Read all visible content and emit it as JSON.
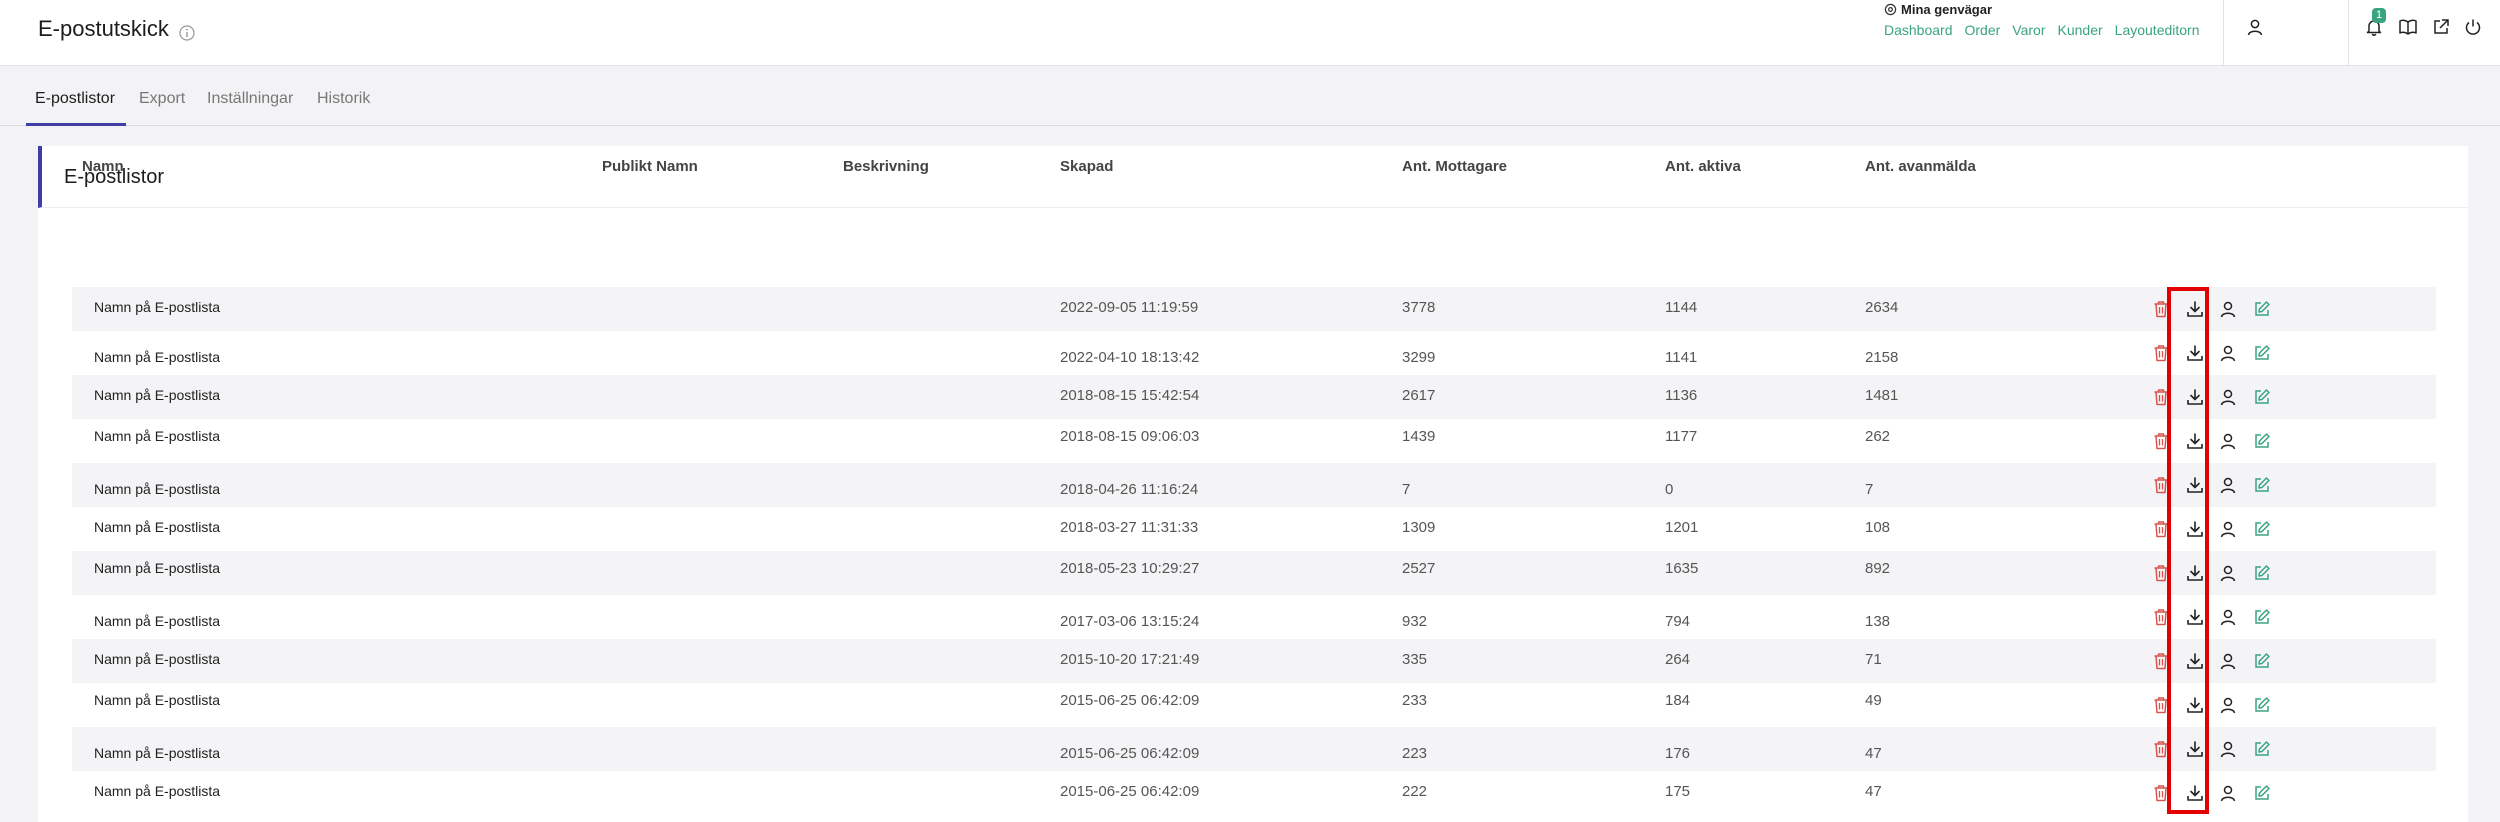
{
  "header": {
    "title": "E-postutskick",
    "shortcuts_title": "Mina genvägar",
    "shortcuts": [
      "Dashboard",
      "Order",
      "Varor",
      "Kunder",
      "Layouteditorn"
    ],
    "notification_count": "1"
  },
  "tabs": [
    "E-postlistor",
    "Export",
    "Inställningar",
    "Historik"
  ],
  "card": {
    "title": "E-postlistor"
  },
  "table": {
    "columns": [
      "Namn",
      "Publikt Namn",
      "Beskrivning",
      "Skapad",
      "Ant. Mottagare",
      "Ant. aktiva",
      "Ant. avanmälda"
    ],
    "rows": [
      {
        "name": "Namn på E-postlista",
        "public": "",
        "desc": "",
        "created": "2022-09-05 11:19:59",
        "recipients": "3778",
        "active": "1144",
        "unsub": "2634"
      },
      {
        "name": "Namn på E-postlista",
        "public": "",
        "desc": "",
        "created": "2022-04-10 18:13:42",
        "recipients": "3299",
        "active": "1141",
        "unsub": "2158"
      },
      {
        "name": "Namn på E-postlista",
        "public": "",
        "desc": "",
        "created": "2018-08-15 15:42:54",
        "recipients": "2617",
        "active": "1136",
        "unsub": "1481"
      },
      {
        "name": "Namn på E-postlista",
        "public": "",
        "desc": "",
        "created": "2018-08-15 09:06:03",
        "recipients": "1439",
        "active": "1177",
        "unsub": "262"
      },
      {
        "name": "Namn på E-postlista",
        "public": "",
        "desc": "",
        "created": "2018-04-26 11:16:24",
        "recipients": "7",
        "active": "0",
        "unsub": "7"
      },
      {
        "name": "Namn på E-postlista",
        "public": "",
        "desc": "",
        "created": "2018-03-27 11:31:33",
        "recipients": "1309",
        "active": "1201",
        "unsub": "108"
      },
      {
        "name": "Namn på E-postlista",
        "public": "",
        "desc": "",
        "created": "2018-05-23 10:29:27",
        "recipients": "2527",
        "active": "1635",
        "unsub": "892"
      },
      {
        "name": "Namn på E-postlista",
        "public": "",
        "desc": "",
        "created": "2017-03-06 13:15:24",
        "recipients": "932",
        "active": "794",
        "unsub": "138"
      },
      {
        "name": "Namn på E-postlista",
        "public": "",
        "desc": "",
        "created": "2015-10-20 17:21:49",
        "recipients": "335",
        "active": "264",
        "unsub": "71"
      },
      {
        "name": "Namn på E-postlista",
        "public": "",
        "desc": "",
        "created": "2015-06-25 06:42:09",
        "recipients": "233",
        "active": "184",
        "unsub": "49"
      },
      {
        "name": "Namn på E-postlista",
        "public": "",
        "desc": "",
        "created": "2015-06-25 06:42:09",
        "recipients": "223",
        "active": "176",
        "unsub": "47"
      },
      {
        "name": "Namn på E-postlista",
        "public": "",
        "desc": "",
        "created": "2015-06-25 06:42:09",
        "recipients": "222",
        "active": "175",
        "unsub": "47"
      }
    ],
    "row_actions": [
      "trash-icon",
      "download-icon",
      "user-icon",
      "edit-icon"
    ]
  },
  "colors": {
    "accent": "#3e3ea6",
    "link_green": "#3aa382",
    "danger_red": "#d9534f",
    "highlight_red": "#e30000"
  }
}
